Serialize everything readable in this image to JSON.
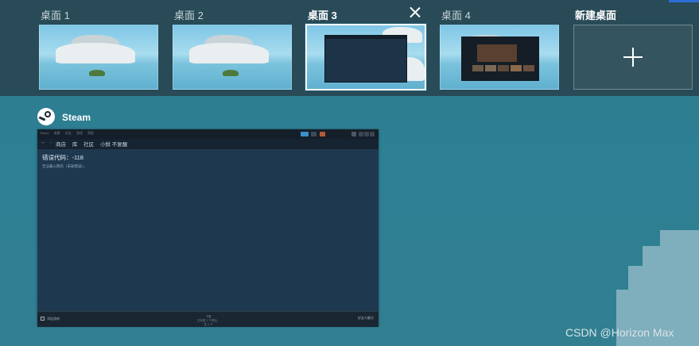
{
  "desktops": [
    {
      "label": "桌面 1",
      "active": false
    },
    {
      "label": "桌面 2",
      "active": false
    },
    {
      "label": "桌面 3",
      "active": true
    },
    {
      "label": "桌面 4",
      "active": false
    }
  ],
  "new_desktop_label": "新建桌面",
  "app": {
    "name": "Steam",
    "window": {
      "menus": [
        "Steam",
        "查看",
        "好友",
        "游戏",
        "帮助"
      ],
      "nav_links": [
        "商店",
        "库",
        "社区",
        "小鲜 不复醒"
      ],
      "error_title": "错误代码：-118",
      "error_desc": "无法载入网页（未知错误）。",
      "footer_left": "添加游戏",
      "footer_mid_line1": "下载",
      "footer_mid_line2": "已完成 1 个项目，共 1 个",
      "footer_right": "好友与聊天"
    }
  },
  "watermark": "CSDN @Horizon Max",
  "colors": {
    "accent": "#2b6fd6",
    "steam_bg": "#1e3850"
  }
}
